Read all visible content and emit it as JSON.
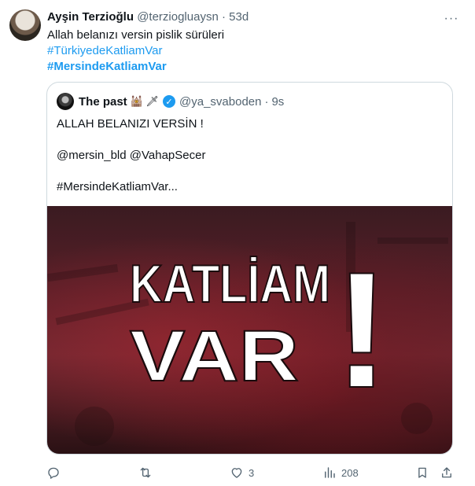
{
  "tweet": {
    "author_name": "Ayşin Terzioğlu",
    "handle": "@terziogluaysn",
    "separator": "·",
    "time": "53d",
    "more_glyph": "···",
    "text_line": "Allah belanızı versin pislik sürüleri",
    "hashtag1": "#TürkiyedeKatliamVar",
    "hashtag2": "#MersindeKatliamVar"
  },
  "quote": {
    "author_name": "The past",
    "emoji": "🕍 🗡",
    "verified_glyph": "✓",
    "handle": "@ya_svaboden",
    "separator": "·",
    "time": "9s",
    "line1": "ALLAH BELANIZI VERSİN  !",
    "line2": "@mersin_bld @VahapSecer",
    "line3": "#MersindeKatliamVar...",
    "image_text_line1": "KATLİAM",
    "image_text_line2": "VAR",
    "image_exclamation": "!"
  },
  "actions": {
    "reply_count": "",
    "retweet_count": "",
    "like_count": "3",
    "views_count": "208"
  },
  "colors": {
    "link": "#1d9bf0",
    "muted": "#536471",
    "text": "#0f1419",
    "border": "#cfd9de"
  }
}
